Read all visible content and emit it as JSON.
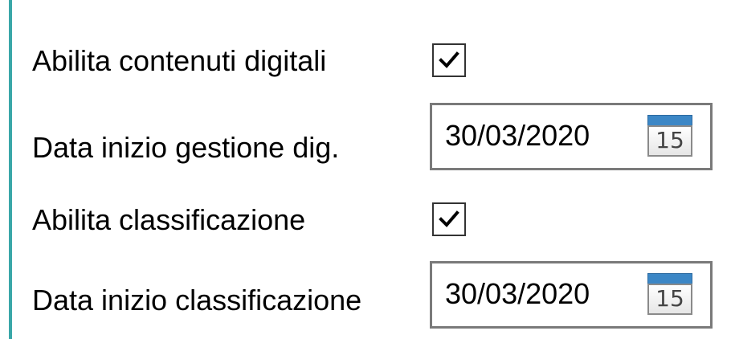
{
  "rows": [
    {
      "label": "Abilita contenuti digitali",
      "type": "checkbox",
      "checked": true
    },
    {
      "label": "Data inizio gestione dig.",
      "type": "date",
      "value": "30/03/2020",
      "calendar_day": "15"
    },
    {
      "label": "Abilita classificazione",
      "type": "checkbox",
      "checked": true
    },
    {
      "label": "Data inizio classificazione",
      "type": "date",
      "value": "30/03/2020",
      "calendar_day": "15"
    }
  ],
  "colors": {
    "accent": "#3aa7a8",
    "calendar_header": "#3c87c6"
  },
  "icons": {
    "checkmark": "check-icon",
    "calendar": "calendar-icon"
  }
}
